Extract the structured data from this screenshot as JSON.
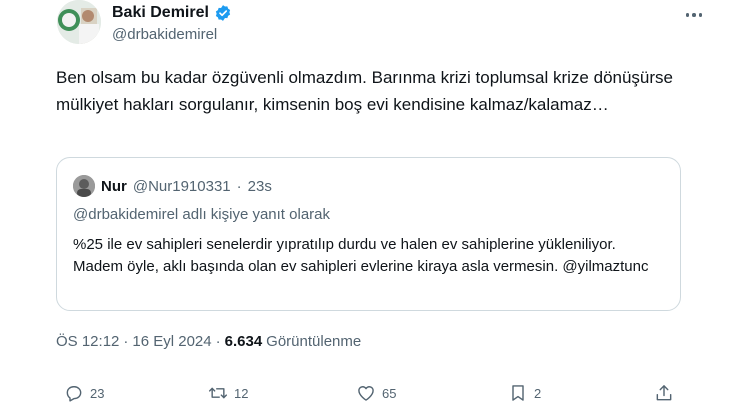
{
  "author": {
    "display_name": "Baki Demirel",
    "handle": "@drbakidemirel",
    "verified_color": "#1d9bf0"
  },
  "tweet": {
    "text": "Ben olsam bu kadar özgüvenli olmazdım. Barınma krizi toplumsal krize dönüşürse mülkiyet hakları sorgulanır, kimsenin boş evi kendisine kalmaz/kalamaz…"
  },
  "quote": {
    "name": "Nur",
    "handle": "@Nur1910331",
    "dot": "·",
    "time": "23s",
    "reply_mention": "@drbakidemirel",
    "reply_suffix": " adlı kişiye yanıt olarak",
    "text": "%25 ile ev sahipleri senelerdir yıpratılıp durdu ve halen ev sahiplerine yükleniliyor. Madem öyle, aklı başında olan ev sahipleri evlerine kiraya asla vermesin. @yilmaztunc"
  },
  "meta": {
    "time": "ÖS 12:12",
    "dot1": "·",
    "date": "16 Eyl 2024",
    "dot2": "·",
    "views": "6.634",
    "views_label": "Görüntülenme"
  },
  "actions": {
    "replies": "23",
    "retweets": "12",
    "likes": "65",
    "bookmarks": "2",
    "icons": [
      "reply-icon",
      "retweet-icon",
      "like-icon",
      "bookmark-icon",
      "share-icon"
    ]
  }
}
